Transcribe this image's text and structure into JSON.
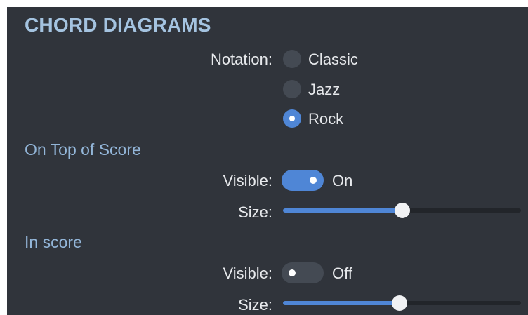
{
  "title": "CHORD DIAGRAMS",
  "notation": {
    "label": "Notation:",
    "options": [
      "Classic",
      "Jazz",
      "Rock"
    ],
    "selected": "Rock"
  },
  "on_top_of_score": {
    "heading": "On Top of Score",
    "visible_label": "Visible:",
    "visible_state": "On",
    "size_label": "Size:",
    "size_value": 0.5
  },
  "in_score": {
    "heading": "In score",
    "visible_label": "Visible:",
    "visible_state": "Off",
    "size_label": "Size:",
    "size_value": 0.49
  },
  "colors": {
    "panel_background": "#30343b",
    "accent": "#4f86d6",
    "heading": "#a4c3e0"
  }
}
